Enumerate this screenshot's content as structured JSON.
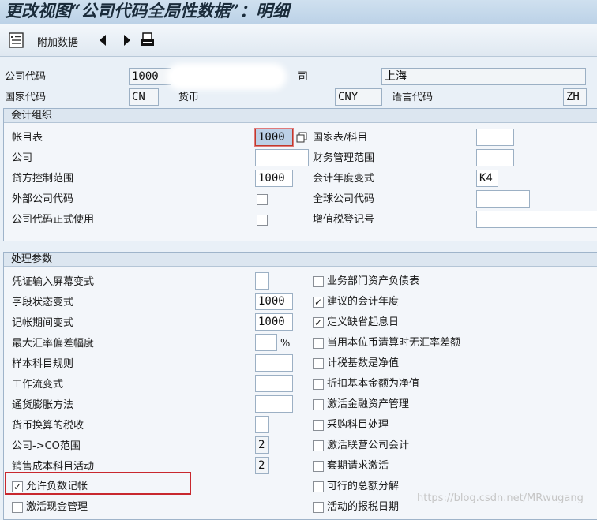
{
  "title": "更改视图“公司代码全局性数据”：明细",
  "toolbar": {
    "additional_data_label": "附加数据"
  },
  "header": {
    "company_code_label": "公司代码",
    "company_code_value": "1000",
    "company_name_partial": "司",
    "city_value": "上海",
    "country_label": "国家代码",
    "country_value": "CN",
    "currency_label": "货币",
    "currency_value": "CNY",
    "language_label": "语言代码",
    "language_value": "ZH"
  },
  "accounting_org": {
    "title": "会计组织",
    "chart_of_accounts_label": "帐目表",
    "chart_of_accounts_value": "1000",
    "country_chart_label": "国家表/科目",
    "company_label": "公司",
    "fm_area_label": "财务管理范围",
    "credit_control_label": "贷方控制范围",
    "credit_control_value": "1000",
    "fiscal_year_variant_label": "会计年度变式",
    "fiscal_year_variant_value": "K4",
    "external_company_label": "外部公司代码",
    "global_company_label": "全球公司代码",
    "company_productive_label": "公司代码正式使用",
    "vat_reg_label": "增值税登记号"
  },
  "processing": {
    "title": "处理参数",
    "left_rows": [
      {
        "label": "凭证输入屏幕变式",
        "value": ""
      },
      {
        "label": "字段状态变式",
        "value": "1000"
      },
      {
        "label": "记帐期间变式",
        "value": "1000"
      },
      {
        "label": "最大汇率偏差幅度",
        "value": "",
        "suffix": "%"
      },
      {
        "label": "样本科目规则",
        "value": ""
      },
      {
        "label": "工作流变式",
        "value": ""
      },
      {
        "label": "通货膨胀方法",
        "value": ""
      },
      {
        "label": "货币换算的税收",
        "value": ""
      },
      {
        "label": "公司->CO范围",
        "value": "2"
      },
      {
        "label": "销售成本科目活动",
        "value": "2"
      }
    ],
    "right_checks": [
      {
        "label": "业务部门资产负债表",
        "checked": false
      },
      {
        "label": "建议的会计年度",
        "checked": true
      },
      {
        "label": "定义缺省起息日",
        "checked": true
      },
      {
        "label": "当用本位币清算时无汇率差额",
        "checked": false
      },
      {
        "label": "计税基数是净值",
        "checked": false
      },
      {
        "label": "折扣基本金额为净值",
        "checked": false
      },
      {
        "label": "激活金融资产管理",
        "checked": false
      },
      {
        "label": "采购科目处理",
        "checked": false
      },
      {
        "label": "激活联营公司会计",
        "checked": false
      },
      {
        "label": "套期请求激活",
        "checked": false
      },
      {
        "label": "可行的总额分解",
        "checked": false
      },
      {
        "label": "活动的报税日期",
        "checked": false
      }
    ],
    "left_checks": [
      {
        "label": "允许负数记帐",
        "checked": true
      },
      {
        "label": "激活现金管理",
        "checked": false
      }
    ]
  },
  "watermark": "https://blog.csdn.net/MRwugang"
}
